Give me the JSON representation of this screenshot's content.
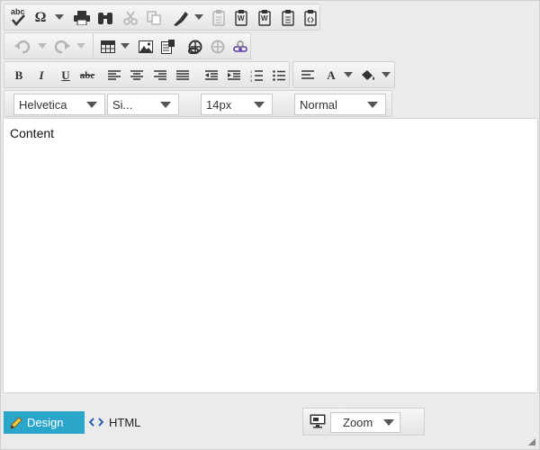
{
  "toolbar": {
    "row1": {
      "spellcheck": {
        "icon": "spellcheck-icon",
        "glyph": "abc"
      },
      "special_char": {
        "icon": "omega-icon",
        "glyph": "Ω"
      },
      "print": {
        "icon": "print-icon"
      },
      "find": {
        "icon": "binoculars-icon"
      },
      "cut": {
        "icon": "scissors-icon"
      },
      "copy": {
        "icon": "copy-icon"
      },
      "paste": {
        "icon": "paint-brush-icon"
      },
      "paste_text": {
        "icon": "clipboard-text-icon"
      },
      "paste_word": {
        "icon": "clipboard-word-icon",
        "glyph": "W"
      },
      "paste_word2": {
        "icon": "clipboard-word-icon",
        "glyph": "W"
      },
      "paste_plain": {
        "icon": "clipboard-icon"
      },
      "paste_html": {
        "icon": "clipboard-html-icon"
      }
    },
    "row3": {
      "bold_glyph": "B",
      "italic_glyph": "I",
      "underline_glyph": "U",
      "strike_glyph": "abc",
      "font_color_glyph": "A"
    },
    "row4": {
      "font_name": "Helvetica",
      "font_size_class": "Si...",
      "font_size": "14px",
      "format": "Normal"
    }
  },
  "content": {
    "text": "Content"
  },
  "bottom": {
    "design_label": "Design",
    "html_label": "HTML",
    "zoom_label": "Zoom"
  },
  "colors": {
    "accent": "#2ba6cb",
    "toolbar_bg": "#ebebeb",
    "icon": "#333333",
    "disabled_icon": "#b4b4b4"
  }
}
